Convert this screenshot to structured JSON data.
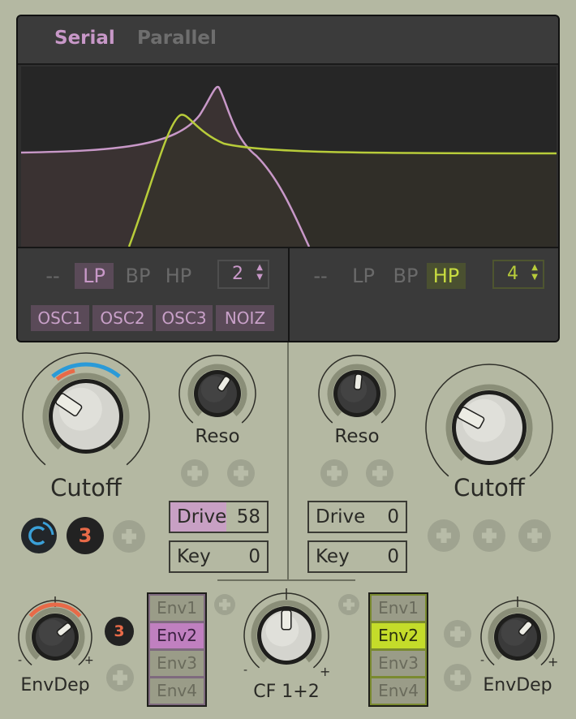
{
  "tabs": {
    "serial": "Serial",
    "parallel": "Parallel",
    "active": "Serial"
  },
  "colors": {
    "filter1": "#c898c8",
    "filter2": "#b8cc3a",
    "bg": "#b4b8a2"
  },
  "filter1": {
    "types": [
      "--",
      "LP",
      "BP",
      "HP"
    ],
    "selected": "LP",
    "slope": "2",
    "sources": [
      "OSC1",
      "OSC2",
      "OSC3",
      "NOIZ"
    ],
    "cutoff_label": "Cutoff",
    "cutoff": 0.3,
    "reso_label": "Reso",
    "reso": 0.62,
    "drive_label": "Drive",
    "drive": "58",
    "key_label": "Key",
    "key": "0",
    "mod_badge": "3",
    "env_depth_label": "EnvDep",
    "env_depth": 0.68,
    "env_badge": "3"
  },
  "filter2": {
    "types": [
      "--",
      "LP",
      "BP",
      "HP"
    ],
    "selected": "HP",
    "slope": "4",
    "cutoff_label": "Cutoff",
    "cutoff": 0.28,
    "reso_label": "Reso",
    "reso": 0.52,
    "drive_label": "Drive",
    "drive": "0",
    "key_label": "Key",
    "key": "0",
    "env_depth_label": "EnvDep",
    "env_depth": 0.65
  },
  "crossfade": {
    "label": "CF 1+2",
    "value": 0.5
  },
  "env_left": {
    "items": [
      "Env1",
      "Env2",
      "Env3",
      "Env4"
    ],
    "selected": "Env2"
  },
  "env_right": {
    "items": [
      "Env1",
      "Env2",
      "Env3",
      "Env4"
    ],
    "selected": "Env2"
  },
  "knob_signs": {
    "minus": "-",
    "plus": "+"
  }
}
